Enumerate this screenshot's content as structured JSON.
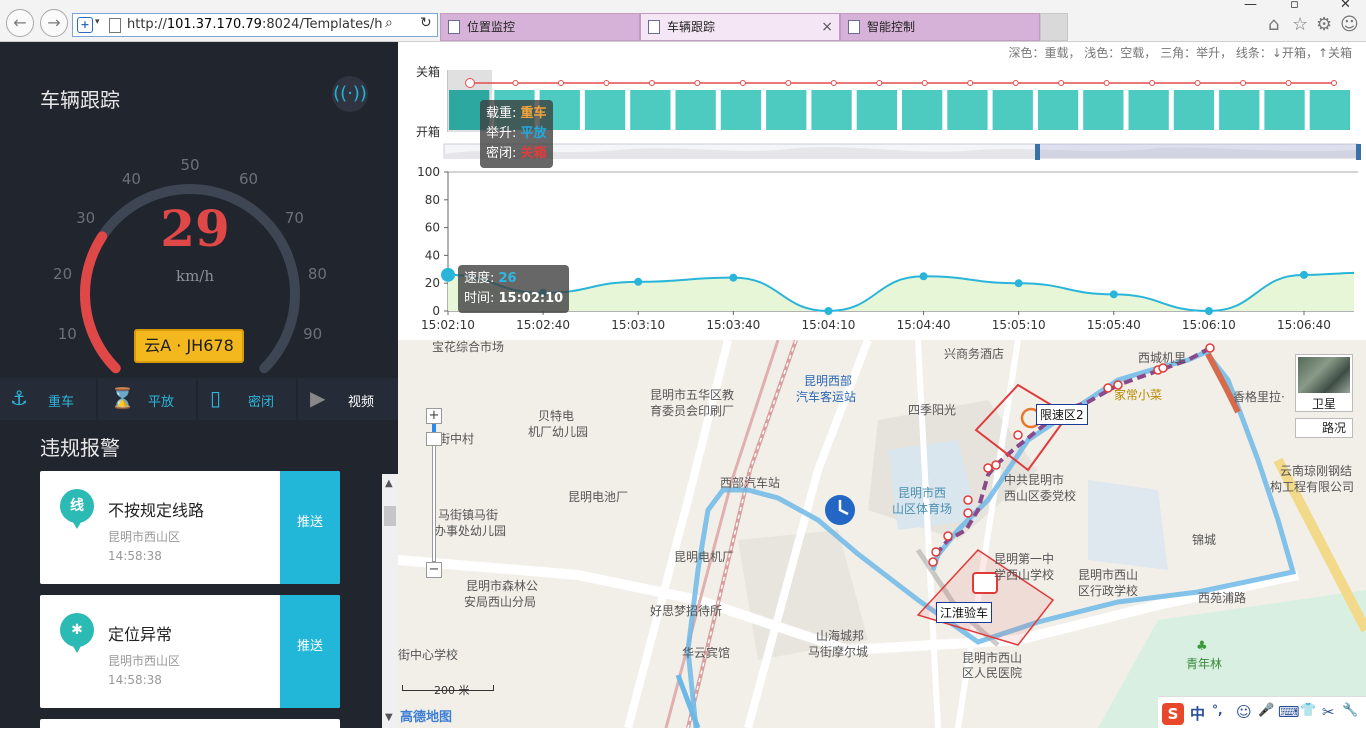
{
  "browser": {
    "url_prefix": "http://",
    "url_host": "101.37.170.79",
    "url_rest": ":8024/Templates/home",
    "tabs": [
      {
        "label": "位置监控",
        "active": false
      },
      {
        "label": "车辆跟踪",
        "active": true
      },
      {
        "label": "智能控制",
        "active": false
      }
    ],
    "tab_close": "×"
  },
  "left": {
    "title": "车辆跟踪",
    "gauge": {
      "ticks": [
        "10",
        "20",
        "30",
        "40",
        "50",
        "60",
        "70",
        "80",
        "90"
      ],
      "value": "29",
      "value_num": 29,
      "max": 100,
      "unit": "km/h",
      "accent": "#e04848"
    },
    "plate": "云A · JH678",
    "status": [
      {
        "label": "重车",
        "icon": "anchor-icon",
        "glyph": "⚓"
      },
      {
        "label": "平放",
        "icon": "hourglass-icon",
        "glyph": "⌛"
      },
      {
        "label": "密闭",
        "icon": "lock-bar-icon",
        "glyph": "▯"
      },
      {
        "label": "视频",
        "icon": "play-icon",
        "glyph": "▶"
      }
    ],
    "alarm_title": "违规报警",
    "alarms": [
      {
        "icon_text": "线",
        "title": "不按规定线路",
        "location": "昆明市西山区",
        "time": "14:58:38",
        "action": "推送"
      },
      {
        "icon_text": "✱",
        "title": "定位异常",
        "location": "昆明市西山区",
        "time": "14:58:38",
        "action": "推送"
      }
    ]
  },
  "chart": {
    "legend_note": "深色：重载， 浅色：空载， 三角：举升， 线条：↓开箱，↑关箱",
    "top_chart": {
      "y_labels": [
        "关箱",
        "开箱"
      ],
      "bar_count": 20,
      "bar_color": "#4ecbc0",
      "highlight_color": "#2da8a0",
      "line_color": "#e44c4c"
    },
    "tooltip_top": {
      "rows": [
        {
          "key": "载重: ",
          "value": "重车"
        },
        {
          "key": "举升: ",
          "value": "平放"
        },
        {
          "key": "密闭: ",
          "value": "关箱"
        }
      ]
    },
    "tooltip_speed": {
      "speed_key": "速度: ",
      "speed_value": "26",
      "time_key": "时间: ",
      "time_value": "15:02:10"
    }
  },
  "chart_data": {
    "type": "line",
    "series": [
      {
        "values": [
          26,
          13,
          21,
          24,
          0,
          25,
          20,
          12,
          0,
          26
        ]
      }
    ],
    "x": [
      "15:02:10",
      "15:02:40",
      "15:03:10",
      "15:03:40",
      "15:04:10",
      "15:04:40",
      "15:05:10",
      "15:05:40",
      "15:06:10",
      "15:06:40"
    ],
    "y_ticks": [
      0,
      20,
      40,
      60,
      80,
      100
    ],
    "ylim": [
      0,
      100
    ],
    "line_color": "#29b5d9",
    "fill_color": "#e8f6d8"
  },
  "map": {
    "labels": [
      {
        "text": "宝花综合市场",
        "cls": ""
      },
      {
        "text": "昆明市五华区教",
        "cls": ""
      },
      {
        "text": "育委员会印刷厂",
        "cls": ""
      },
      {
        "text": "昆明西部",
        "cls": "blue"
      },
      {
        "text": "汽车客运站",
        "cls": "blue"
      },
      {
        "text": "兴商务酒店",
        "cls": ""
      },
      {
        "text": "西城机里",
        "cls": ""
      },
      {
        "text": "贝特电",
        "cls": ""
      },
      {
        "text": "机厂幼儿园",
        "cls": ""
      },
      {
        "text": "四季阳光",
        "cls": ""
      },
      {
        "text": "家常小菜",
        "cls": "gold"
      },
      {
        "text": "香格里拉·",
        "cls": ""
      },
      {
        "text": "街中村",
        "cls": ""
      },
      {
        "text": "昆明电池厂",
        "cls": ""
      },
      {
        "text": "西部汽车站",
        "cls": ""
      },
      {
        "text": "中共昆明市",
        "cls": ""
      },
      {
        "text": "西山区委党校",
        "cls": ""
      },
      {
        "text": "昆明市西",
        "cls": "teal"
      },
      {
        "text": "山区体育场",
        "cls": "teal"
      },
      {
        "text": "云南琼刚钢结",
        "cls": ""
      },
      {
        "text": "构工程有限公司",
        "cls": ""
      },
      {
        "text": "马街镇马街",
        "cls": ""
      },
      {
        "text": "办事处幼儿园",
        "cls": ""
      },
      {
        "text": "昆明电机厂",
        "cls": ""
      },
      {
        "text": "锦城",
        "cls": ""
      },
      {
        "text": "昆明第一中",
        "cls": ""
      },
      {
        "text": "学西山学校",
        "cls": ""
      },
      {
        "text": "昆明市西山",
        "cls": ""
      },
      {
        "text": "区行政学校",
        "cls": ""
      },
      {
        "text": "昆明市森林公",
        "cls": ""
      },
      {
        "text": "安局西山分局",
        "cls": ""
      },
      {
        "text": "西苑浦路",
        "cls": ""
      },
      {
        "text": "好思梦招待所",
        "cls": ""
      },
      {
        "text": "山海城邦",
        "cls": ""
      },
      {
        "text": "马街摩尔城",
        "cls": ""
      },
      {
        "text": "街中心学校",
        "cls": ""
      },
      {
        "text": "华云宾馆",
        "cls": ""
      },
      {
        "text": "昆明市西山",
        "cls": ""
      },
      {
        "text": "区人民医院",
        "cls": ""
      },
      {
        "text": "青年林",
        "cls": "green"
      }
    ],
    "tag_limit": "限速区2",
    "tag_check": "江淮验车",
    "satellite": "卫星",
    "traffic": "路况",
    "scale": "200 米",
    "logo": "高德地图",
    "zoom_in": "+",
    "zoom_out": "−",
    "ime_items": [
      "中",
      "°,",
      "☺",
      "🎤",
      "⌨",
      "👕",
      "✂",
      "🔧"
    ]
  }
}
